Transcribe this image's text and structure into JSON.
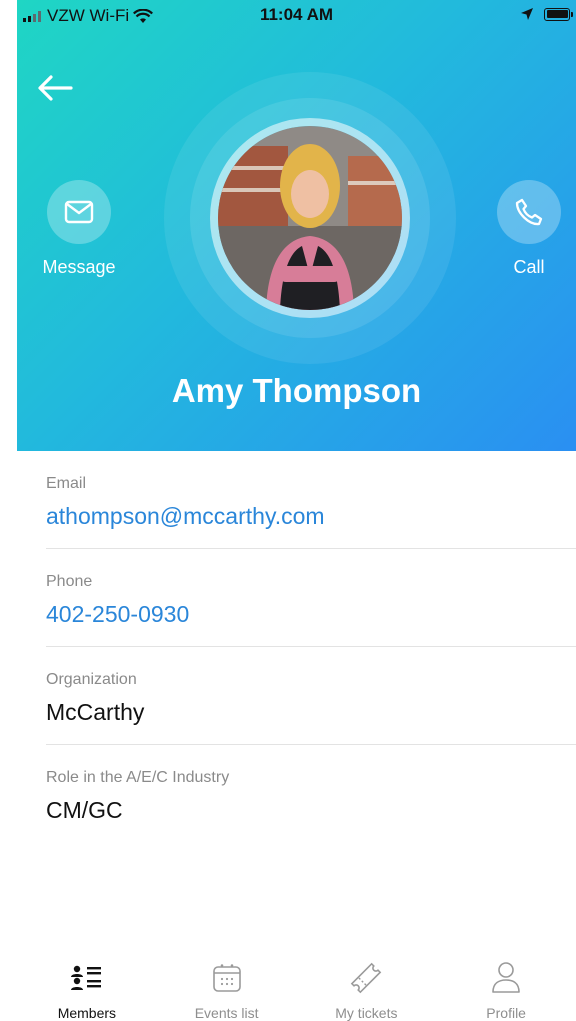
{
  "status_bar": {
    "carrier": "VZW Wi-Fi",
    "time": "11:04 AM"
  },
  "profile": {
    "name": "Amy Thompson",
    "message_label": "Message",
    "call_label": "Call"
  },
  "fields": [
    {
      "label": "Email",
      "value": "athompson@mccarthy.com"
    },
    {
      "label": "Phone",
      "value": "402-250-0930"
    },
    {
      "label": "Organization",
      "value": "McCarthy"
    },
    {
      "label": "Role in the A/E/C Industry",
      "value": "CM/GC"
    }
  ],
  "tabs": [
    {
      "label": "Members",
      "icon": "members-icon",
      "active": true
    },
    {
      "label": "Events list",
      "icon": "calendar-icon"
    },
    {
      "label": "My tickets",
      "icon": "ticket-icon"
    },
    {
      "label": "Profile",
      "icon": "user-icon"
    }
  ],
  "colors": {
    "gradient_start": "#1fd6c4",
    "gradient_end": "#2a8ff2",
    "link": "#2a86d9"
  }
}
